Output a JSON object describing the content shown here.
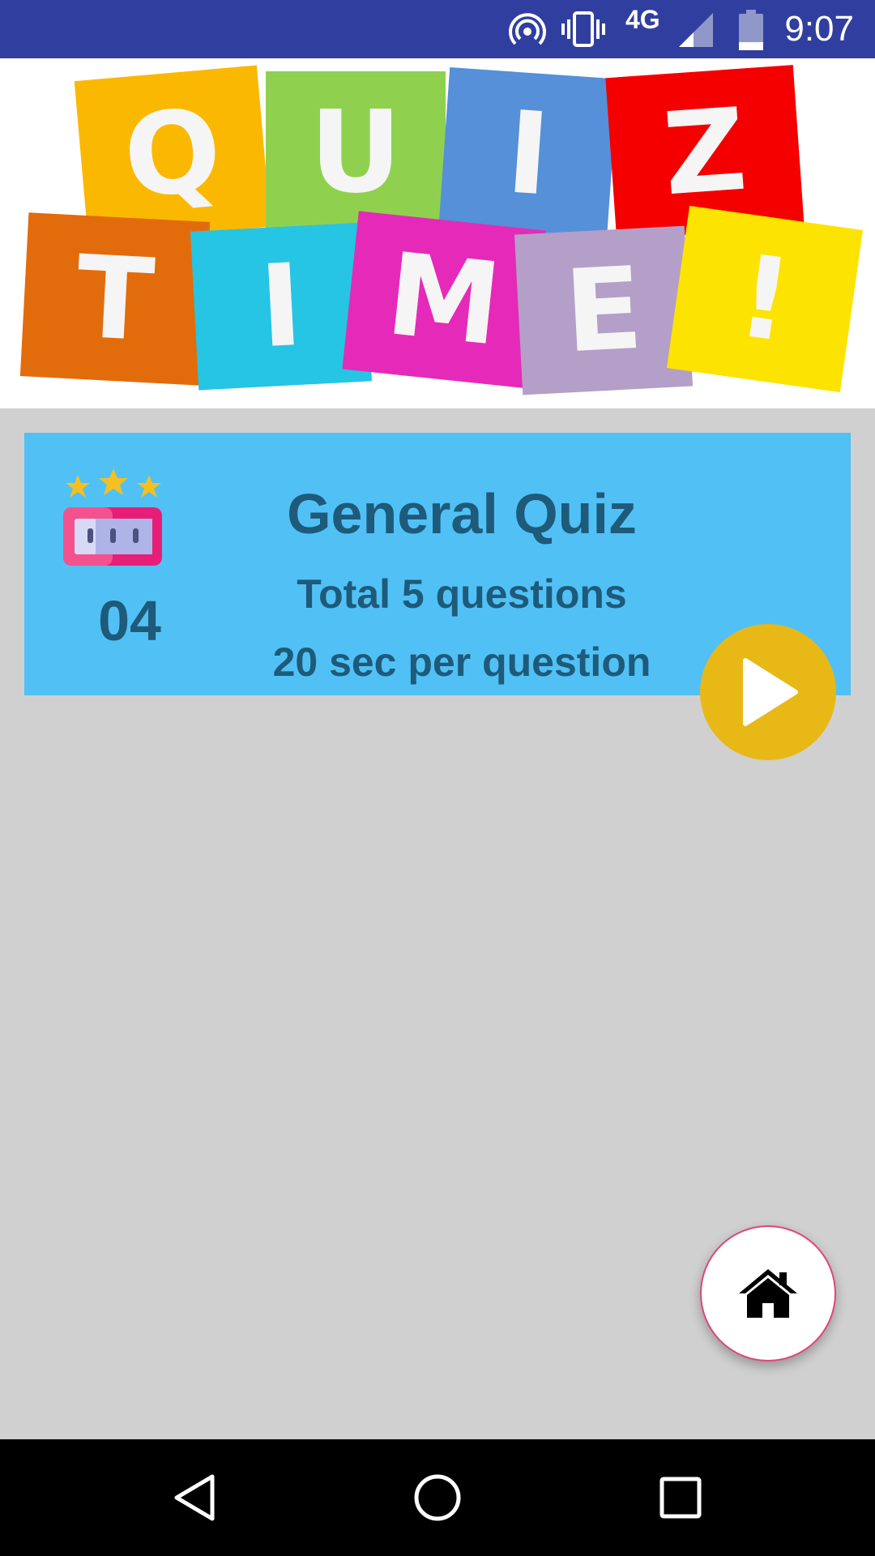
{
  "status_bar": {
    "time": "9:07",
    "network": "4G",
    "icons": [
      "hotspot-icon",
      "vibrate-icon",
      "signal-icon",
      "battery-icon"
    ],
    "color": "#303f9f"
  },
  "banner": {
    "row1": [
      {
        "letter": "Q",
        "color": "#fbb800"
      },
      {
        "letter": "U",
        "color": "#8fd14f"
      },
      {
        "letter": "I",
        "color": "#5590d8"
      },
      {
        "letter": "Z",
        "color": "#f40000"
      }
    ],
    "row2": [
      {
        "letter": "T",
        "color": "#e26c0c"
      },
      {
        "letter": "I",
        "color": "#25c5e3"
      },
      {
        "letter": "M",
        "color": "#e52ab9"
      },
      {
        "letter": "E",
        "color": "#b39fc8"
      },
      {
        "letter": "!",
        "color": "#fde300"
      }
    ]
  },
  "quiz_card": {
    "title": "General Quiz",
    "questions_text": "Total 5 questions",
    "time_text": "20 sec per question",
    "count": "04",
    "background": "#51c1f5",
    "text_color": "#1e5a7a"
  },
  "buttons": {
    "play_icon": "play-icon",
    "play_color": "#e8b816",
    "home_icon": "home-icon"
  },
  "nav_bar": {
    "items": [
      "back-icon",
      "home-circle-icon",
      "recents-icon"
    ]
  }
}
